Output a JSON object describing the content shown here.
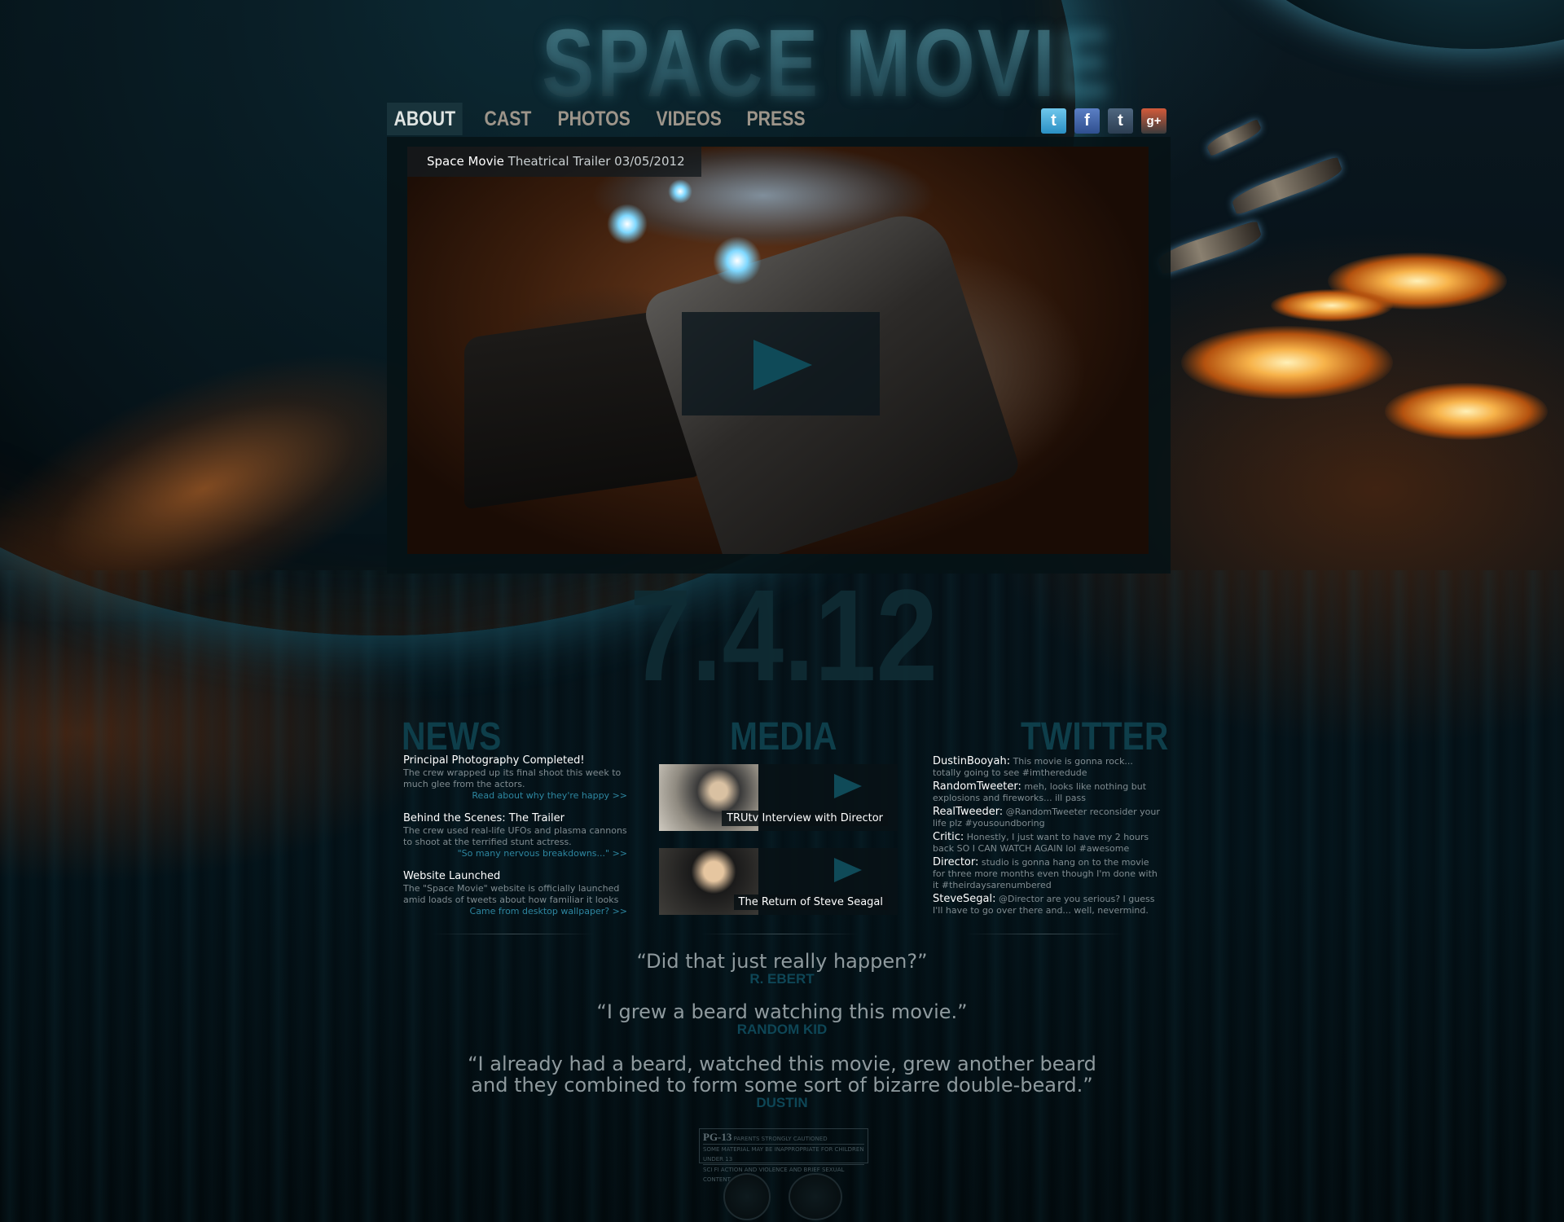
{
  "logo": {
    "title": "SPACE MOVIE"
  },
  "nav": {
    "items": [
      {
        "label": "ABOUT",
        "active": true
      },
      {
        "label": "CAST",
        "active": false
      },
      {
        "label": "PHOTOS",
        "active": false
      },
      {
        "label": "VIDEOS",
        "active": false
      },
      {
        "label": "PRESS",
        "active": false
      }
    ]
  },
  "social": {
    "twitter": "t",
    "facebook": "f",
    "tumblr": "t",
    "google_plus": "g+"
  },
  "video": {
    "caption_title": "Space Movie",
    "caption_sub": "Theatrical Trailer 03/05/2012"
  },
  "release_date": "7.4.12",
  "news": {
    "heading": "NEWS",
    "items": [
      {
        "title": "Principal Photography Completed!",
        "body": "The crew wrapped up its final shoot this week to much glee from the actors.",
        "link": "Read about why they're happy >>"
      },
      {
        "title": "Behind the Scenes: The Trailer",
        "body": "The crew used real-life UFOs and plasma cannons to shoot at the terrified stunt actress.",
        "link": "\"So many nervous breakdowns...\" >>"
      },
      {
        "title": "Website Launched",
        "body": "The \"Space Movie\" website is officially launched amid loads of tweets about how familiar it looks",
        "link": "Came from desktop wallpaper? >>"
      }
    ]
  },
  "media": {
    "heading": "MEDIA",
    "items": [
      {
        "label": "TRUtv Interview with Director"
      },
      {
        "label": "The Return of Steve Seagal"
      }
    ]
  },
  "twitter": {
    "heading": "TWITTER",
    "tweets": [
      {
        "user": "DustinBooyah:",
        "text": "This movie is gonna rock... totally going to see #imtheredude"
      },
      {
        "user": "RandomTweeter:",
        "text": "meh, looks like nothing but explosions and fireworks... ill pass"
      },
      {
        "user": "RealTweeder:",
        "text": "@RandomTweeter reconsider your life plz #yousoundboring"
      },
      {
        "user": "Critic:",
        "text": "Honestly, I just want to have my 2 hours back SO I CAN WATCH AGAIN lol #awesome"
      },
      {
        "user": "Director:",
        "text": "studio is gonna hang on to the movie for three more months even though I'm done with it #theirdaysarenumbered"
      },
      {
        "user": "SteveSegal:",
        "text": "@Director are you serious? I guess I'll have to go over there and... well, nevermind."
      }
    ]
  },
  "quotes": [
    {
      "text": "“Did that just really happen?”",
      "author": "R. EBERT"
    },
    {
      "text": "“I grew a beard watching this movie.”",
      "author": "RANDOM KID"
    },
    {
      "text_line1": "“I already had a beard, watched this movie, grew another beard",
      "text_line2": "and they combined to form some sort of bizarre double-beard.”",
      "author": "DUSTIN"
    }
  ],
  "rating": {
    "badge": "PG-13",
    "caution": "PARENTS STRONGLY CAUTIONED",
    "line2": "SOME MATERIAL MAY BE INAPPROPRIATE FOR CHILDREN UNDER 13",
    "line3": "SCI FI ACTION AND VIOLENCE AND BRIEF SEXUAL CONTENT"
  },
  "colors": {
    "accent": "#0e4656",
    "link": "#2d86a0",
    "nav_active_bg": "#18333b"
  }
}
